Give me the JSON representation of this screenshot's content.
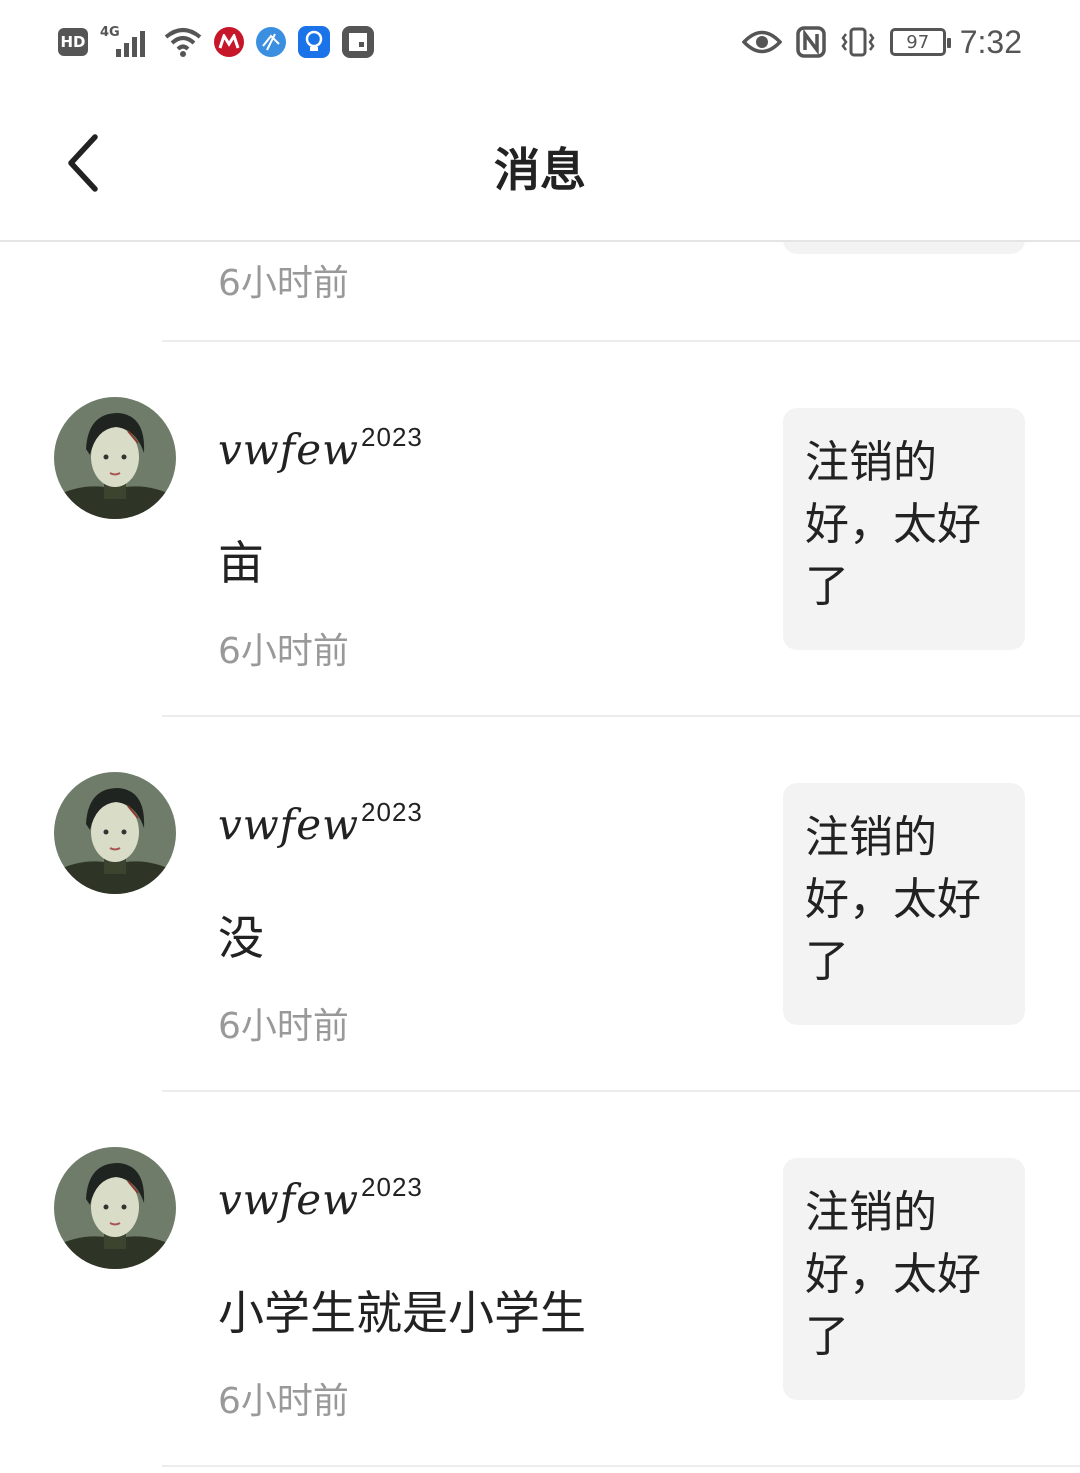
{
  "status_bar": {
    "hd_label": "HD",
    "network_label": "4G",
    "battery_level": "97",
    "time": "7:32"
  },
  "header": {
    "title": "消息"
  },
  "partial_item": {
    "time": "6小时前"
  },
  "items": [
    {
      "username": "vwfew",
      "username_suffix": "2023",
      "message": "亩",
      "time": "6小时前",
      "reference": "注销的好，太好了"
    },
    {
      "username": "vwfew",
      "username_suffix": "2023",
      "message": "没",
      "time": "6小时前",
      "reference": "注销的好，太好了"
    },
    {
      "username": "vwfew",
      "username_suffix": "2023",
      "message": "小学生就是小学生",
      "time": "6小时前",
      "reference": "注销的好，太好了"
    }
  ]
}
